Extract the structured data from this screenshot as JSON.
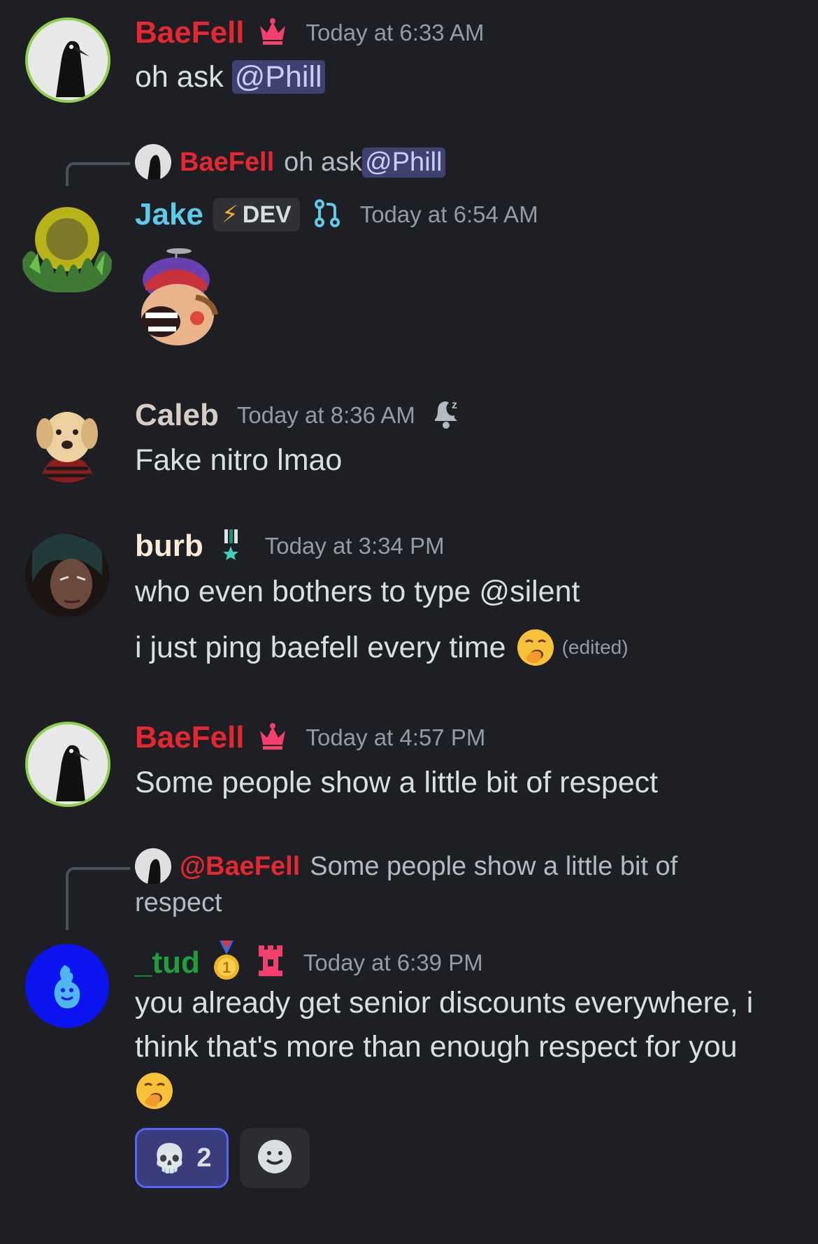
{
  "messages": [
    {
      "user": "BaeFell",
      "time": "Today at 6:33 AM",
      "text_before": "oh ask ",
      "mention": "@Phill"
    },
    {
      "reply": {
        "user": "BaeFell",
        "text": "oh ask ",
        "mention": "@Phill"
      },
      "user": "Jake",
      "badge": "DEV",
      "time": "Today at 6:54 AM"
    },
    {
      "user": "Caleb",
      "time": "Today at 8:36 AM",
      "text": "Fake nitro lmao"
    },
    {
      "user": "burb",
      "time": "Today at 3:34 PM",
      "line1": "who even bothers to type @silent",
      "line2": "i just ping baefell every time",
      "edited": "(edited)"
    },
    {
      "user": "BaeFell",
      "time": "Today at 4:57 PM",
      "text": "Some people show a little bit of respect"
    },
    {
      "reply": {
        "user": "@BaeFell",
        "text_line1": "Some people show a little bit of",
        "text_line2": "respect"
      },
      "user": "_tud",
      "time": "Today at 6:39 PM",
      "line1": "you already get senior discounts everywhere, i",
      "line2": "think that's more than enough respect for you",
      "reactions": [
        {
          "emoji": "💀",
          "count": "2"
        }
      ]
    }
  ],
  "colors": {
    "background": "#1e1f24",
    "owner_red": "#e5282f",
    "jake_cyan": "#5fc9e8",
    "tud_green": "#1f9f3a",
    "mention_bg": "#3d4270"
  }
}
